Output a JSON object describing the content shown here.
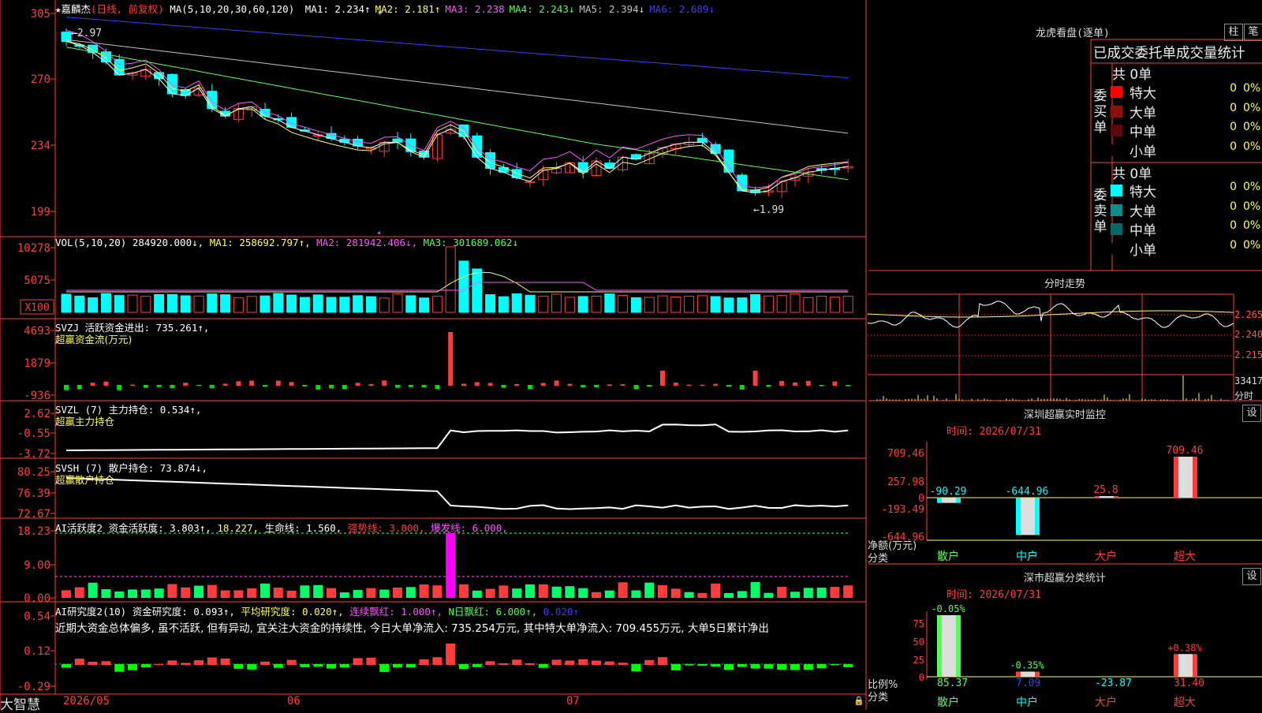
{
  "stock": {
    "name": "嘉麟杰",
    "period": "(日线, 前复权)",
    "ma_label": "MA(5,10,20,30,60,120)",
    "ma": [
      {
        "name": "MA1:",
        "value": "2.234↑",
        "color": "#ffffff"
      },
      {
        "name": "MA2:",
        "value": "2.181↑",
        "color": "#ffff54"
      },
      {
        "name": "MA3:",
        "value": "2.238",
        "color": "#ff54ff"
      },
      {
        "name": "MA4:",
        "value": "2.243↓",
        "color": "#54ff54"
      },
      {
        "name": "MA5:",
        "value": "2.394↓",
        "color": "#c0c0c0"
      },
      {
        "name": "MA6:",
        "value": "2.689↓",
        "color": "#3c3cff"
      }
    ],
    "high_mark": "2.97",
    "low_mark": "1.99",
    "price_axis": [
      "305",
      "270",
      "234",
      "199"
    ]
  },
  "volume": {
    "title": "VOL(5,10,20)",
    "value": "284920.000↓,",
    "ma1": "MA1: 258692.797↑,",
    "ma2": "MA2: 281942.406↓,",
    "ma3": "MA3: 301689.062↓",
    "axis": [
      "10278",
      "5075"
    ],
    "unit": "X100"
  },
  "svzj": {
    "title": "SVZJ  活跃资金进出: 735.261↑,",
    "subtitle": "超赢资金流(万元)",
    "axis": [
      "4693",
      "1879",
      "-936"
    ]
  },
  "svzl": {
    "title": "SVZL (7) 主力持仓: 0.534↑,",
    "subtitle": "超赢主力持仓",
    "axis": [
      "2.62",
      "-0.55",
      "-3.72"
    ]
  },
  "svsh": {
    "title": "SVSH (7) 散户持仓: 73.874↓,",
    "subtitle": "超赢散户持仓",
    "axis": [
      "80.25",
      "76.39",
      "72.67"
    ]
  },
  "ai_active": {
    "prefix": "AI活跃度2 资金活跃度: 3.803↑,",
    "v2": "18.227,",
    "v3": "生命线: 1.560,",
    "v4": "强势线: 3.000,",
    "v5": "爆发线: 6.000,",
    "axis": [
      "18.23",
      "9.00",
      "0.00"
    ]
  },
  "ai_research": {
    "prefix": "AI研究度2(10) 资金研究度: 0.093↑,",
    "v2": "平均研究度: 0.020↑,",
    "v3": "连续飘红: 1.000↑,",
    "v4": "N日飘红: 6.000↑,",
    "v5": "0.020↑",
    "comment": "近期大资金总体偏多, 虽不活跃, 但有异动, 宜关注大资金的持续性, 今日大单净流入: 735.254万元, 其中特大单净流入: 709.455万元, 大单5日累计净出",
    "axis": [
      "0.54",
      "0.12",
      "-0.29"
    ]
  },
  "bottom_bar": {
    "brand": "大智慧",
    "dates": [
      "2026/05",
      "06",
      "07"
    ]
  },
  "lhb": {
    "title": "龙虎看盘(逐单)",
    "btn1": "柱",
    "btn2": "笔",
    "subtitle": "已成交委托单成交量统计",
    "buy_label": [
      "委",
      "买",
      "单"
    ],
    "sell_label": [
      "委",
      "卖",
      "单"
    ],
    "buy_total": "共 0单",
    "sell_total": "共 0单",
    "buy_rows": [
      {
        "name": "特大",
        "count": "0",
        "pct": "0%",
        "color": "#ff0000"
      },
      {
        "name": "大单",
        "count": "0",
        "pct": "0%",
        "color": "#8c1010"
      },
      {
        "name": "中单",
        "count": "0",
        "pct": "0%",
        "color": "#5a0a0a"
      },
      {
        "name": "小单",
        "count": "0",
        "pct": "0%",
        "color": "#000000"
      }
    ],
    "sell_rows": [
      {
        "name": "特大",
        "count": "0",
        "pct": "0%",
        "color": "#00ffff"
      },
      {
        "name": "大单",
        "count": "0",
        "pct": "0%",
        "color": "#108c8c"
      },
      {
        "name": "中单",
        "count": "0",
        "pct": "0%",
        "color": "#0a6666"
      },
      {
        "name": "小单",
        "count": "0",
        "pct": "0%",
        "color": "#000000"
      }
    ]
  },
  "minute": {
    "title": "分时走势",
    "axis": [
      "2.265",
      "2.240",
      "2.215"
    ],
    "vol_label": "33417",
    "vol_unit": "分时"
  },
  "sz_monitor": {
    "title": "深圳超赢实时监控",
    "btn": "设",
    "time": "时间: 2026/07/31",
    "yaxis": [
      "709.46",
      "257.98",
      "0",
      "-193.49",
      "-644.96"
    ],
    "net_label": "净额(万元)",
    "cat_label": "分类",
    "cats": [
      "散户",
      "中户",
      "大户",
      "超大"
    ],
    "values": [
      -90.29,
      -644.96,
      25.8,
      709.46
    ],
    "value_labels": [
      "-90.29",
      "-644.96",
      "25.8",
      "709.46"
    ]
  },
  "sz_class": {
    "title": "深市超赢分类统计",
    "btn": "设",
    "time": "时间: 2026/07/31",
    "yaxis": [
      "75",
      "50",
      "25",
      "0"
    ],
    "ratio_label": "比例%",
    "cat_label": "分类",
    "cats": [
      "散户",
      "中户",
      "大户",
      "超大"
    ],
    "ratios": [
      85.37,
      7.09,
      -23.87,
      31.4
    ],
    "ratio_labels": [
      "85.37",
      "7.09",
      "-23.87",
      "31.40"
    ],
    "change_labels": [
      "-0.05%",
      "-0.35%",
      "",
      "+0.38%"
    ]
  }
}
